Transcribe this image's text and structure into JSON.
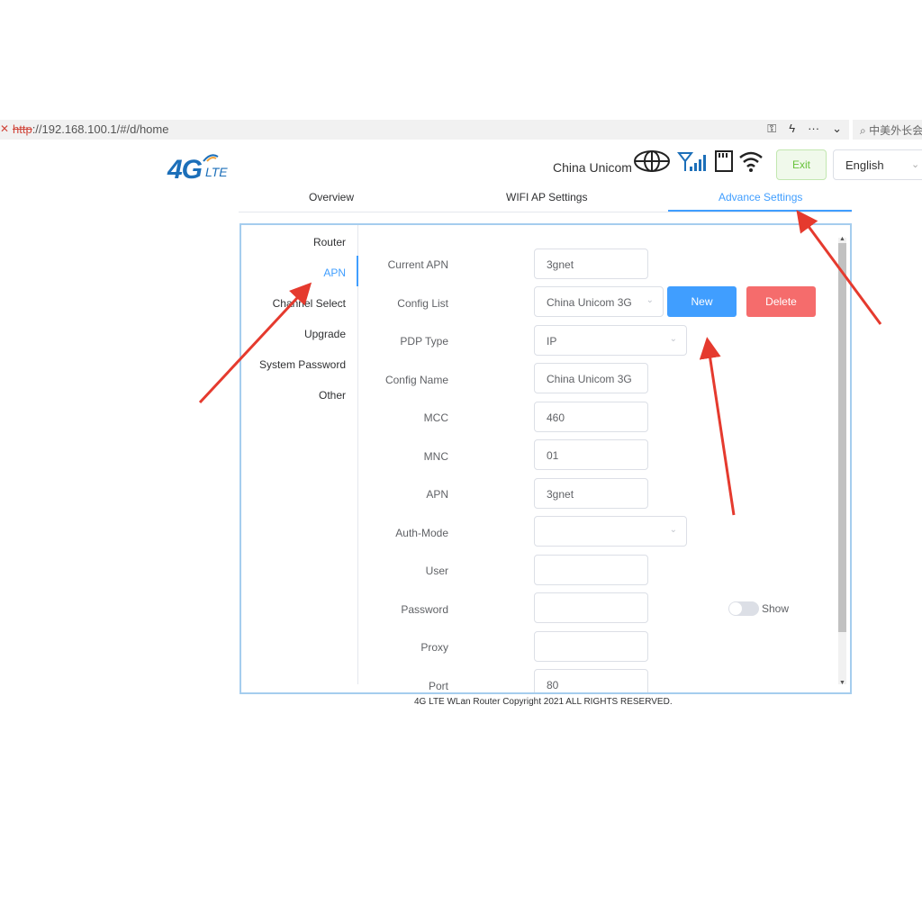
{
  "browser": {
    "url_protocol": "http",
    "url_rest": "://192.168.100.1/#/d/home",
    "search_text": "中美外长会",
    "tools": [
      "key-icon",
      "bolt-icon",
      "more-icon",
      "chevron-down-icon"
    ]
  },
  "header": {
    "logo_big": "4G",
    "logo_small": "LTE",
    "carrier": "China Unicom",
    "exit_label": "Exit",
    "language": "English"
  },
  "tabs": [
    {
      "label": "Overview"
    },
    {
      "label": "WIFI AP Settings"
    },
    {
      "label": "Advance Settings",
      "active": true
    }
  ],
  "sidebar": {
    "items": [
      {
        "label": "Router"
      },
      {
        "label": "APN",
        "active": true
      },
      {
        "label": "Channel Select"
      },
      {
        "label": "Upgrade"
      },
      {
        "label": "System Password"
      },
      {
        "label": "Other"
      }
    ]
  },
  "form": {
    "current_apn": {
      "label": "Current APN",
      "value": "3gnet"
    },
    "config_list": {
      "label": "Config List",
      "value": "China Unicom 3G"
    },
    "pdp_type": {
      "label": "PDP Type",
      "value": "IP"
    },
    "config_name": {
      "label": "Config Name",
      "value": "China Unicom 3G"
    },
    "mcc": {
      "label": "MCC",
      "value": "460"
    },
    "mnc": {
      "label": "MNC",
      "value": "01"
    },
    "apn": {
      "label": "APN",
      "value": "3gnet"
    },
    "auth_mode": {
      "label": "Auth-Mode",
      "value": ""
    },
    "user": {
      "label": "User",
      "value": ""
    },
    "password": {
      "label": "Password",
      "value": ""
    },
    "proxy": {
      "label": "Proxy",
      "value": ""
    },
    "port": {
      "label": "Port",
      "value": "80"
    },
    "new_label": "New",
    "delete_label": "Delete",
    "show_label": "Show",
    "show_enabled": false
  },
  "footer": "4G LTE WLan Router Copyright 2021 ALL RIGHTS RESERVED.",
  "colors": {
    "primary": "#409eff",
    "danger": "#f56c6c",
    "success": "#67c23a",
    "annotation": "#e53a2e"
  }
}
